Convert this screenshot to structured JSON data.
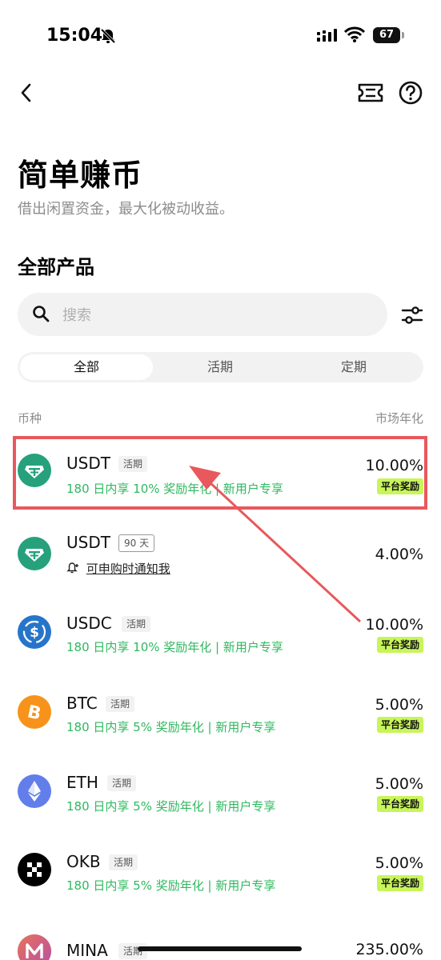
{
  "status": {
    "time": "15:04",
    "battery": "67"
  },
  "header": {
    "title": "简单赚币",
    "subtitle": "借出闲置资金，最大化被动收益。"
  },
  "section": {
    "title": "全部产品"
  },
  "search": {
    "placeholder": "搜索"
  },
  "tabs": [
    {
      "label": "全部",
      "active": true
    },
    {
      "label": "活期",
      "active": false
    },
    {
      "label": "定期",
      "active": false
    }
  ],
  "columns": {
    "left": "币种",
    "right": "市场年化"
  },
  "products": [
    {
      "coin": "USDT",
      "tag": "活期",
      "promo": "180 日内享 10% 奖励年化 | 新用户专享",
      "rate": "10.00%",
      "badge": "平台奖励",
      "color": "#26a17b",
      "highlighted": true
    },
    {
      "coin": "USDT",
      "tag": "90 天",
      "notify": "可申购时通知我",
      "rate": "4.00%",
      "color": "#26a17b"
    },
    {
      "coin": "USDC",
      "tag": "活期",
      "promo": "180 日内享 10% 奖励年化 | 新用户专享",
      "rate": "10.00%",
      "badge": "平台奖励",
      "color": "#2775ca"
    },
    {
      "coin": "BTC",
      "tag": "活期",
      "promo": "180 日内享 5% 奖励年化 | 新用户专享",
      "rate": "5.00%",
      "badge": "平台奖励",
      "color": "#f7931a"
    },
    {
      "coin": "ETH",
      "tag": "活期",
      "promo": "180 日内享 5% 奖励年化 | 新用户专享",
      "rate": "5.00%",
      "badge": "平台奖励",
      "color": "#627eea"
    },
    {
      "coin": "OKB",
      "tag": "活期",
      "promo": "180 日内享 5% 奖励年化 | 新用户专享",
      "rate": "5.00%",
      "badge": "平台奖励",
      "color": "#000000"
    },
    {
      "coin": "MINA",
      "tag": "活期",
      "rate": "235.00%",
      "color": "#e9725a"
    }
  ],
  "colors": {
    "accent_green": "#2fb85f",
    "reward_badge": "#c8f55a",
    "annotation_red": "#e8585c"
  }
}
